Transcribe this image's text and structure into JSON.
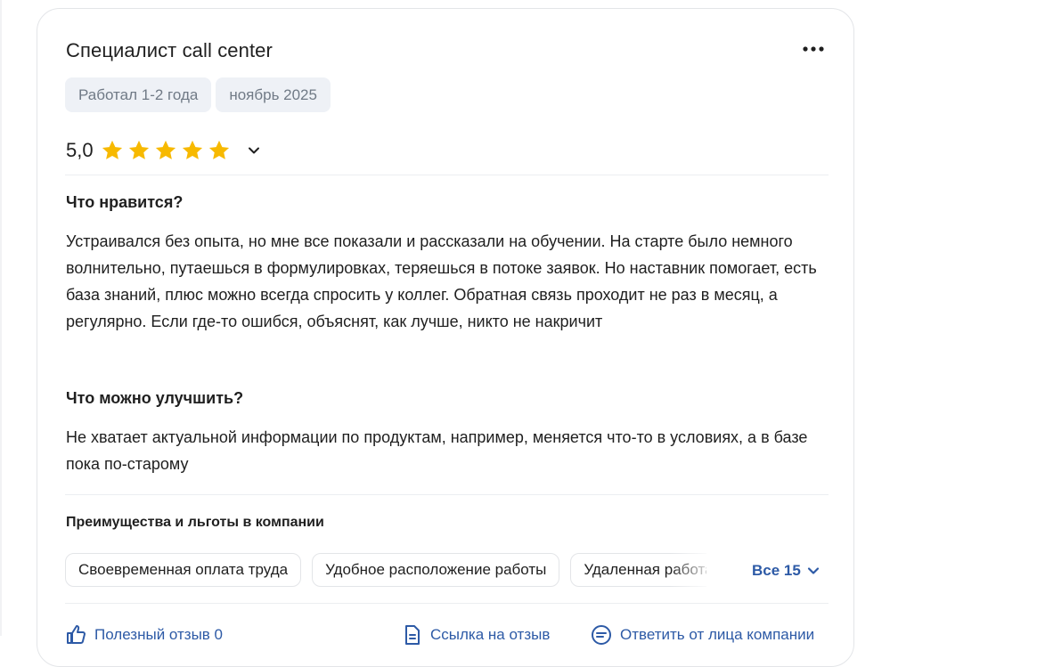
{
  "review": {
    "title": "Специалист call center",
    "tags": [
      "Работал 1-2 года",
      "ноябрь 2025"
    ],
    "rating_value": "5,0",
    "rating_stars": 5,
    "star_color": "#f7b900",
    "likes_heading": "Что нравится?",
    "likes_text": "Устраивался без опыта, но мне все показали и рассказали на обучении. На старте было немного волнительно, путаешься в формулировках, теряешься в потоке заявок. Но наставник помогает, есть база знаний, плюс можно всегда спросить у коллег. Обратная связь проходит не раз в месяц, а регулярно. Если где-то ошибся, объяснят, как лучше, никто не накричит",
    "improve_heading": "Что можно улучшить?",
    "improve_text": "Не хватает актуальной информации по продуктам, например, меняется что-то в условиях, а в базе пока по-старому",
    "benefits_heading": "Преимущества и льготы в компании",
    "benefits": [
      "Своевременная оплата труда",
      "Удобное расположение работы",
      "Удаленная работа"
    ],
    "benefits_all": "Все 15",
    "actions": {
      "useful": "Полезный отзыв 0",
      "link": "Ссылка на отзыв",
      "reply": "Ответить от лица компании"
    }
  },
  "colors": {
    "accent": "#2d5aa6",
    "chip_bg": "#eef1f6",
    "chip_text": "#707a86"
  },
  "icons": [
    "more-icon",
    "star-icon",
    "chevron-down-icon",
    "thumbs-up-icon",
    "link-icon",
    "reply-icon"
  ]
}
